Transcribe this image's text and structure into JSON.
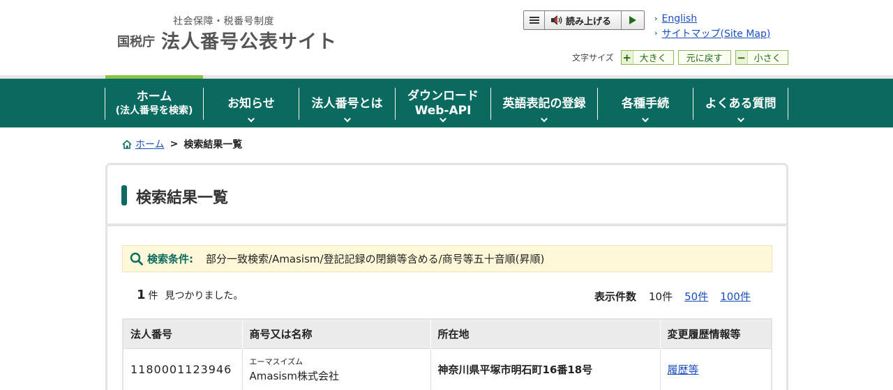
{
  "header": {
    "logo_subtitle": "社会保障・税番号制度",
    "logo_agency": "国税庁",
    "logo_title": "法人番号公表サイト",
    "read_aloud_label": "読み上げる",
    "links": [
      {
        "label": "English"
      },
      {
        "label": "サイトマップ(Site Map)"
      }
    ],
    "font_size": {
      "label": "文字サイズ",
      "large": "大きく",
      "reset": "元に戻す",
      "small": "小さく",
      "large_symbol": "+",
      "small_symbol": "−"
    }
  },
  "nav": {
    "items": [
      {
        "line1": "ホーム",
        "line2": "(法人番号を検索)"
      },
      {
        "line1": "お知らせ",
        "line2": ""
      },
      {
        "line1": "法人番号とは",
        "line2": ""
      },
      {
        "line1": "ダウンロード",
        "line2": "Web-API"
      },
      {
        "line1": "英語表記の登録",
        "line2": ""
      },
      {
        "line1": "各種手続",
        "line2": ""
      },
      {
        "line1": "よくある質問",
        "line2": ""
      }
    ]
  },
  "breadcrumb": {
    "home": "ホーム",
    "separator": ">",
    "current": "検索結果一覧"
  },
  "main": {
    "title": "検索結果一覧",
    "condition_label": "検索条件:",
    "condition_value": "部分一致検索/Amasism/登記記録の閉鎖等含める/商号等五十音順(昇順)",
    "found_count": "1",
    "found_unit": "件",
    "found_message": "見つかりました。",
    "per_page": {
      "label": "表示件数",
      "current": "10件",
      "options": [
        "50件",
        "100件"
      ]
    },
    "table": {
      "headers": [
        "法人番号",
        "商号又は名称",
        "所在地",
        "変更履歴情報等"
      ],
      "rows": [
        {
          "number": "1180001123946",
          "furigana": "エーマスイズム",
          "name": "Amasism株式会社",
          "address": "神奈川県平塚市明石町16番18号",
          "history": "履歴等"
        }
      ]
    }
  },
  "colors": {
    "brand_green": "#0a6a5f",
    "accent_light_green": "#8bc34a",
    "link_blue": "#1a4fc2",
    "condition_bg": "#fff9da"
  }
}
